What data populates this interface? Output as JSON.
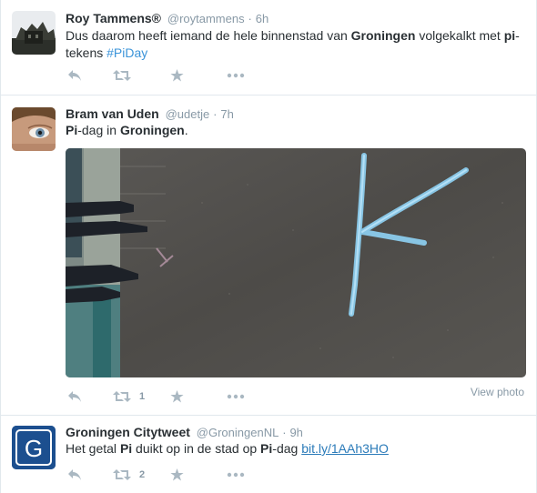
{
  "tweets": [
    {
      "fullname": "Roy Tammens®",
      "username": "@roytammens",
      "separator": "·",
      "time": "6h",
      "text": {
        "p1": "Dus daarom heeft iemand de hele binnenstad van ",
        "b1": "Groningen",
        "p2": " volgekalkt met ",
        "b2": "pi",
        "p3": "-tekens ",
        "hashtag": "#PiDay"
      }
    },
    {
      "fullname": "Bram van Uden",
      "username": "@udetje",
      "separator": "·",
      "time": "7h",
      "text": {
        "b1": "Pi",
        "p1": "-dag in ",
        "b2": "Groningen",
        "p2": "."
      },
      "retweet_count": "1",
      "view_photo": "View photo"
    },
    {
      "fullname": "Groningen Citytweet",
      "username": "@GroningenNL",
      "separator": "·",
      "time": "9h",
      "avatar_letter": "G",
      "text": {
        "p1": "Het getal ",
        "b1": "Pi",
        "p2": " duikt op in de stad op ",
        "b2": "Pi",
        "p3": "-dag ",
        "link": "bit.ly/1AAh3HO"
      },
      "retweet_count": "2"
    }
  ],
  "icons": {
    "reply": "reply-icon",
    "retweet": "retweet-icon",
    "favorite": "star-icon",
    "more": "more-icon"
  },
  "colors": {
    "icon_gray": "#aab8c2",
    "link_blue": "#2b7bb9",
    "meta_gray": "#8899a6",
    "brand_blue": "#1c4f8f"
  }
}
